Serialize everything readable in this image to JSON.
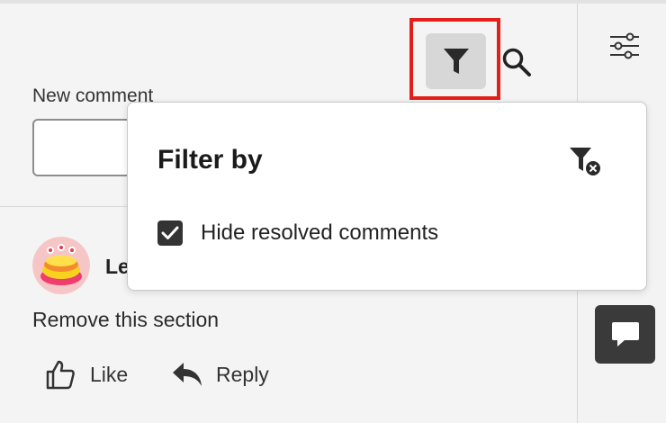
{
  "comments_panel": {
    "new_comment": {
      "label": "New comment",
      "value": "",
      "placeholder": ""
    },
    "comment": {
      "author_visible": "Le",
      "text": "Remove this section",
      "actions": {
        "like_label": "Like",
        "reply_label": "Reply"
      }
    },
    "toolbar": {
      "filter_icon": "funnel-icon",
      "search_icon": "search-icon",
      "filter_active_highlight_color": "#e21f18"
    }
  },
  "filter_popover": {
    "title": "Filter by",
    "clear_icon": "clear-filter-icon",
    "options": [
      {
        "label": "Hide resolved comments",
        "checked": true
      }
    ]
  },
  "right_rail": {
    "settings_icon": "sliders-icon",
    "comments_icon": "comment-bubble-icon",
    "comments_button_color": "#3a3a3a"
  }
}
